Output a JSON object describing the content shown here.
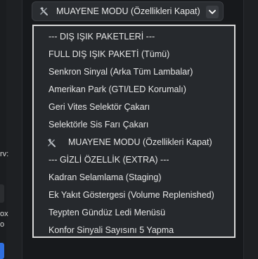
{
  "select": {
    "icon": "tools-icon",
    "value": "MUAYENE MODU (Özellikleri Kapat)",
    "chevron": "chevron-down-icon"
  },
  "dropdown": {
    "options": [
      {
        "label": "--- DIŞ IŞIK PAKETLERİ ---"
      },
      {
        "label": "FULL DIŞ IŞIK PAKETİ (Tümü)"
      },
      {
        "label": "Senkron Sinyal (Arka Tüm Lambalar)"
      },
      {
        "label": "Amerikan Park (GTI/LED Korumalı)"
      },
      {
        "label": "Geri Vites Selektör Çakarı"
      },
      {
        "label": "Selektörle Sis Farı Çakarı"
      },
      {
        "label": "MUAYENE MODU (Özellikleri Kapat)",
        "icon": "tools-icon"
      },
      {
        "label": "--- GİZLİ ÖZELLİK (EXTRA) ---"
      },
      {
        "label": "Kadran Selamlama (Staging)"
      },
      {
        "label": "Ek Yakıt Göstergesi (Volume Replenished)"
      },
      {
        "label": "Teypten Gündüz Ledi Menüsü"
      },
      {
        "label": "Konfor Sinyali Sayısını 5 Yapma"
      }
    ]
  },
  "background": {
    "left_text_1": "rv:",
    "left_text_2": "ox",
    "left_text_3": "o"
  }
}
